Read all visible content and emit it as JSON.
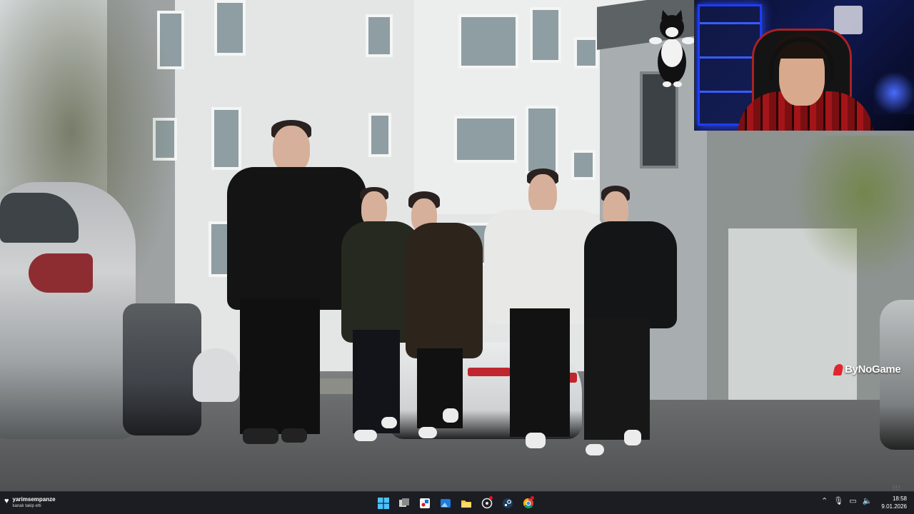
{
  "video": {
    "watermark": "ByNoGame",
    "corner_indicator": "⫶⫶⫶"
  },
  "taskbar": {
    "notification": {
      "title": "yarimsempanze",
      "subtitle": "kanalı takip etti"
    },
    "pinned_apps": [
      {
        "name": "start-button"
      },
      {
        "name": "task-view"
      },
      {
        "name": "snipping-tool"
      },
      {
        "name": "photos-app"
      },
      {
        "name": "file-explorer"
      },
      {
        "name": "app-with-notification"
      },
      {
        "name": "steam"
      },
      {
        "name": "chrome"
      }
    ],
    "clock": {
      "time": "18:58",
      "date": "9.01.2026"
    }
  },
  "colors": {
    "taskbar_bg": "#1c1d22",
    "watermark_logo": "#e0262e",
    "webcam_led": "#1f3cff"
  }
}
